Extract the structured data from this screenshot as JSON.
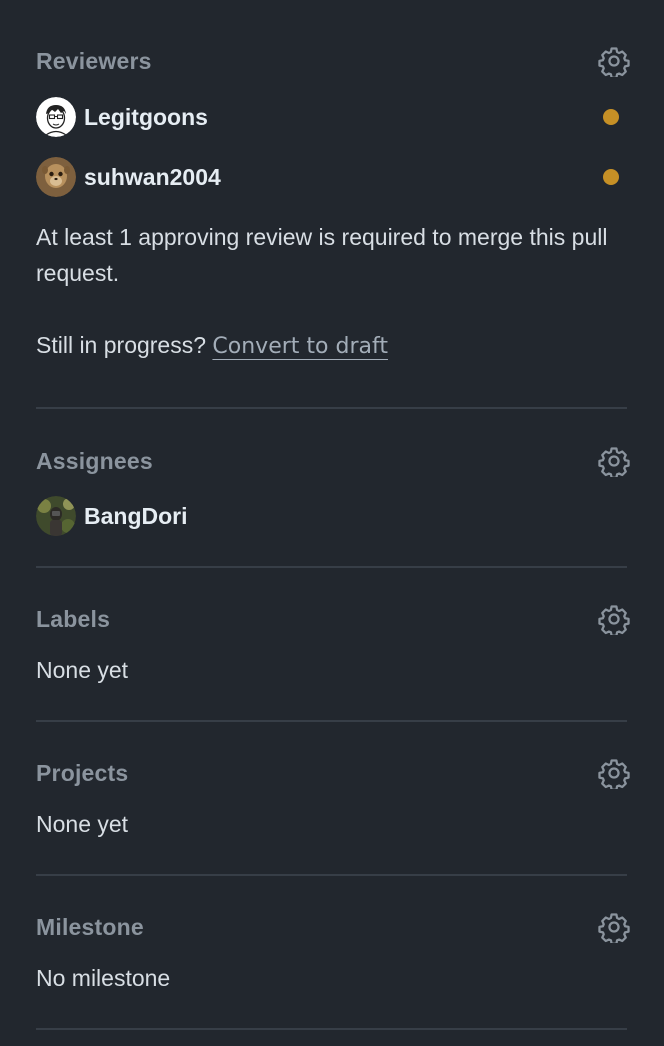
{
  "reviewers": {
    "title": "Reviewers",
    "settings_icon": "gear-icon",
    "users": [
      {
        "name": "Legitgoons",
        "status": "pending"
      },
      {
        "name": "suhwan2004",
        "status": "pending"
      }
    ],
    "requirement_text": "At least 1 approving review is required to merge this pull request.",
    "draft_prompt": "Still in progress?",
    "draft_link": "Convert to draft"
  },
  "assignees": {
    "title": "Assignees",
    "settings_icon": "gear-icon",
    "users": [
      {
        "name": "BangDori"
      }
    ]
  },
  "labels": {
    "title": "Labels",
    "settings_icon": "gear-icon",
    "value": "None yet"
  },
  "projects": {
    "title": "Projects",
    "settings_icon": "gear-icon",
    "value": "None yet"
  },
  "milestone": {
    "title": "Milestone",
    "settings_icon": "gear-icon",
    "value": "No milestone"
  },
  "colors": {
    "background": "#22272e",
    "divider": "#373e47",
    "muted_title": "#8b949e",
    "pending": "#c69026"
  }
}
